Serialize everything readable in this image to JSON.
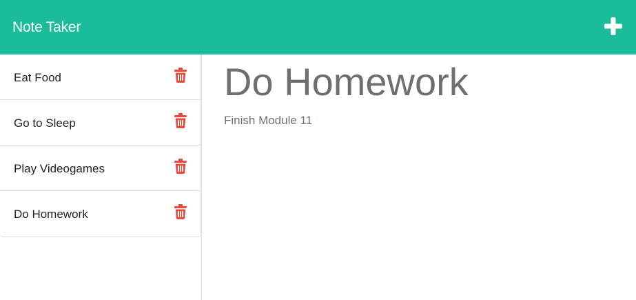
{
  "navbar": {
    "brand": "Note Taker",
    "add_icon": "plus-icon",
    "brand_color": "#1abc9c"
  },
  "notes": [
    {
      "title": "Eat Food",
      "delete_icon": "trash-icon"
    },
    {
      "title": "Go to Sleep",
      "delete_icon": "trash-icon"
    },
    {
      "title": "Play Videogames",
      "delete_icon": "trash-icon"
    },
    {
      "title": "Do Homework",
      "delete_icon": "trash-icon"
    }
  ],
  "active_note": {
    "title": "Do Homework",
    "text": "Finish Module 11"
  },
  "colors": {
    "delete": "#e74c3c"
  }
}
